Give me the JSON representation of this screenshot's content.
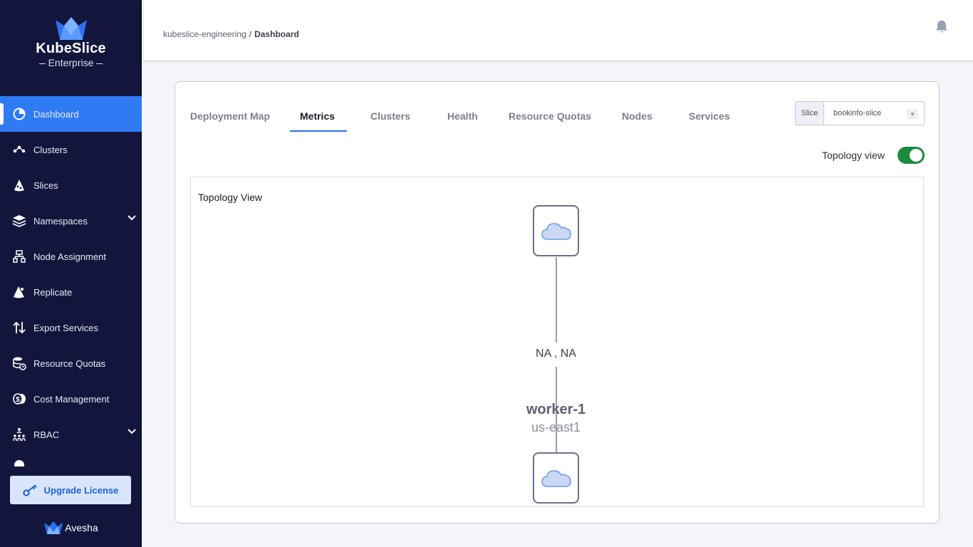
{
  "brand": {
    "name": "KubeSlice",
    "edition": "Enterprise"
  },
  "sidebar": {
    "items": [
      {
        "label": "Dashboard",
        "icon": "pie-chart-icon",
        "active": true
      },
      {
        "label": "Clusters",
        "icon": "cluster-nodes-icon"
      },
      {
        "label": "Slices",
        "icon": "slice-icon"
      },
      {
        "label": "Namespaces",
        "icon": "layers-icon",
        "expandable": true
      },
      {
        "label": "Node Assignment",
        "icon": "node-tree-icon"
      },
      {
        "label": "Replicate",
        "icon": "replicate-icon"
      },
      {
        "label": "Export Services",
        "icon": "up-down-arrows-icon"
      },
      {
        "label": "Resource Quotas",
        "icon": "database-clock-icon"
      },
      {
        "label": "Cost Management",
        "icon": "cost-coins-icon"
      },
      {
        "label": "RBAC",
        "icon": "people-network-icon",
        "expandable": true
      }
    ],
    "upgrade_label": "Upgrade License",
    "footer_brand": "Avesha"
  },
  "header": {
    "breadcrumb": {
      "project": "kubeslice-engineering",
      "separator": "/",
      "current": "Dashboard"
    }
  },
  "main": {
    "tabs": [
      {
        "label": "Deployment Map"
      },
      {
        "label": "Metrics",
        "active": true
      },
      {
        "label": "Clusters"
      },
      {
        "label": "Health"
      },
      {
        "label": "Resource Quotas"
      },
      {
        "label": "Nodes"
      },
      {
        "label": "Services"
      }
    ],
    "slice_select": {
      "label": "Slice",
      "value": "bookinfo-slice"
    },
    "topology_toggle": {
      "label": "Topology view",
      "on": true
    },
    "topology": {
      "title": "Topology View",
      "edge_label": "NA , NA",
      "worker_name": "worker-1",
      "worker_region": "us-east1"
    }
  },
  "colors": {
    "sidebar_bg": "#13163c",
    "accent": "#2f7bf3",
    "toggle_on": "#1d8a3e",
    "upgrade_bg": "#d9e5fb"
  }
}
